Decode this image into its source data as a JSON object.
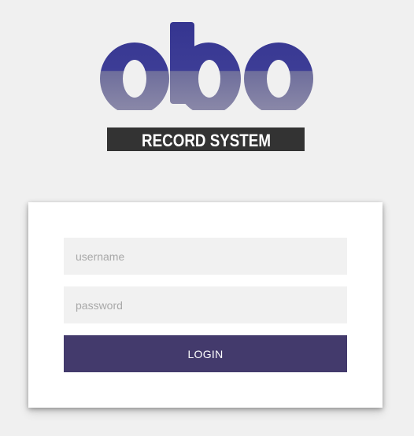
{
  "logo": {
    "wordmark": "obo",
    "tagline": "RECORD SYSTEM",
    "colors": {
      "primary": "#3a3a95",
      "secondary": "#7a7aa0",
      "band": "#333333"
    }
  },
  "login_form": {
    "username_placeholder": "username",
    "username_value": "",
    "password_placeholder": "password",
    "password_value": "",
    "login_label": "LOGIN",
    "button_color": "#433a6c"
  }
}
